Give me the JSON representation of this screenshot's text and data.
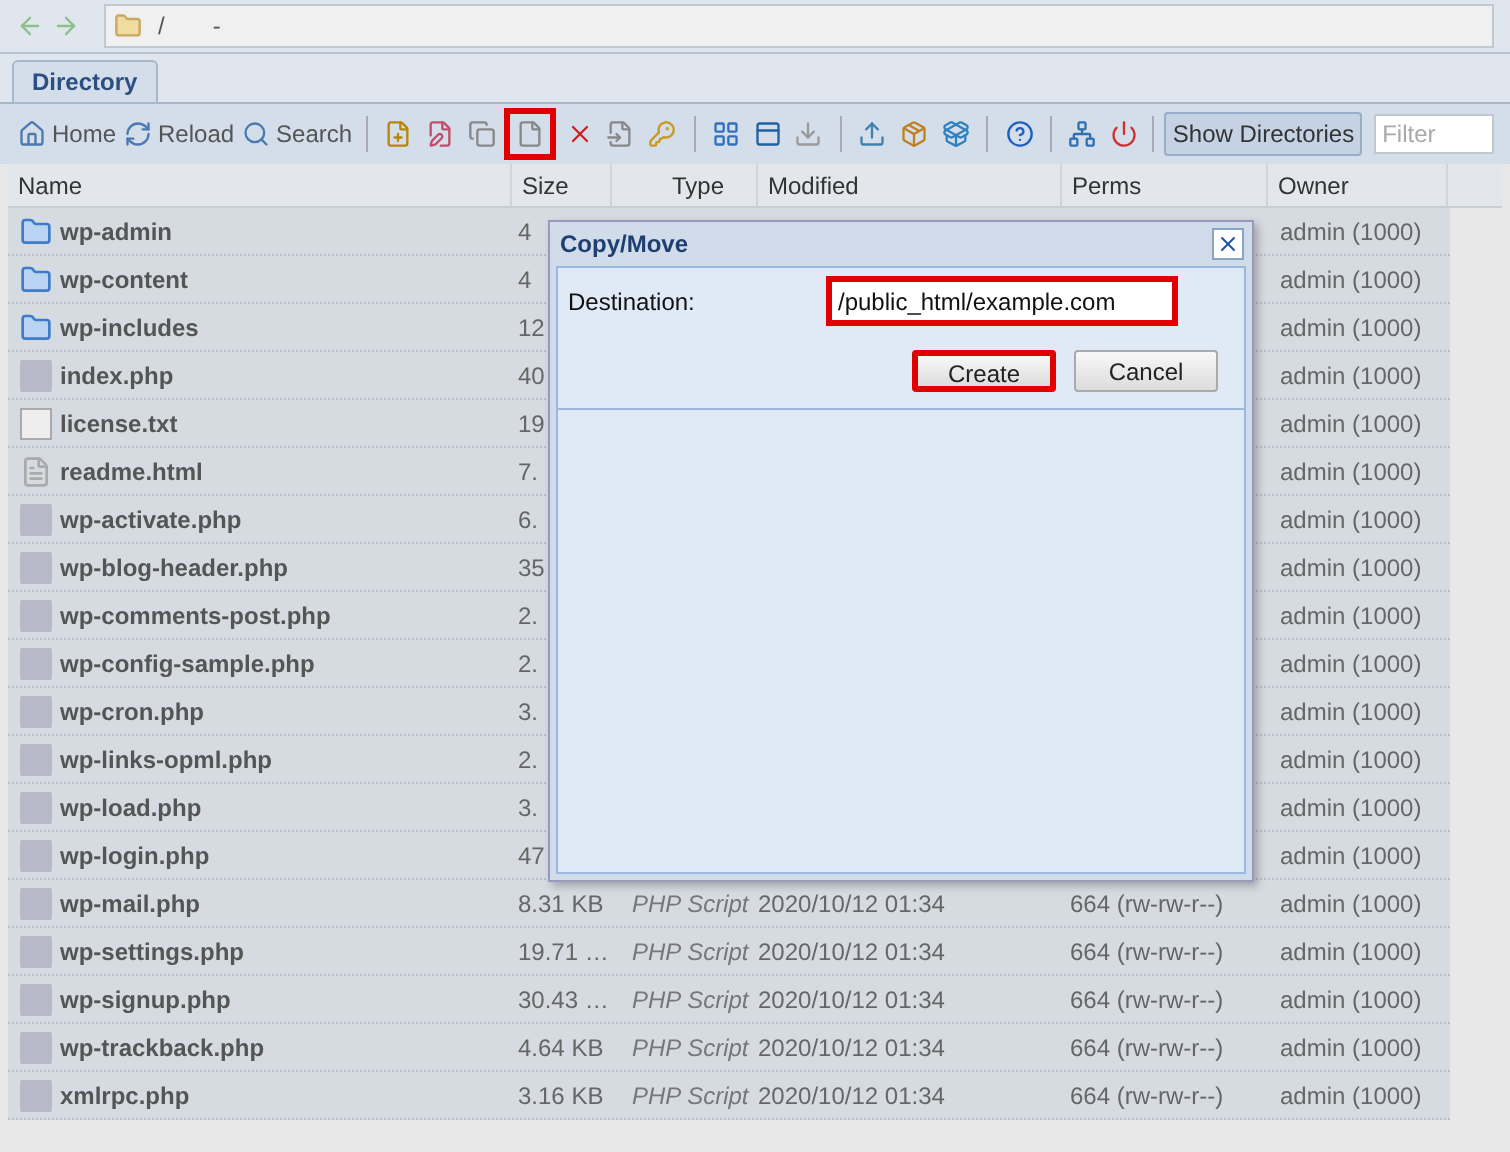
{
  "address_bar": {
    "path": "/",
    "separator": "-"
  },
  "tabs": [
    {
      "label": "Directory",
      "selected": true
    }
  ],
  "toolbar": {
    "nav_buttons": [
      "Home",
      "Reload",
      "Search"
    ],
    "icon_buttons": [
      {
        "highlighted": false
      },
      {
        "highlighted": false
      },
      {
        "highlighted": false
      },
      {
        "highlighted": true
      },
      {
        "highlighted": false
      },
      {
        "highlighted": false
      },
      {
        "highlighted": false
      },
      {
        "highlighted": false
      },
      {
        "highlighted": false
      },
      {
        "highlighted": false
      },
      {
        "highlighted": false
      },
      {
        "highlighted": false
      },
      {
        "highlighted": false
      },
      {
        "highlighted": false
      },
      {
        "highlighted": false
      },
      {
        "highlighted": false
      }
    ],
    "toggle": {
      "label": "Show Directories",
      "on": true
    },
    "filter": {
      "placeholder": "Filter"
    }
  },
  "table": {
    "columns": [
      "Name",
      "Size",
      "Type",
      "Modified",
      "Perms",
      "Owner"
    ],
    "rows": [
      {
        "kind": "folder",
        "name": "wp-admin",
        "size": "4",
        "owner": "admin (1000)"
      },
      {
        "kind": "folder",
        "name": "wp-content",
        "size": "4",
        "owner": "admin (1000)"
      },
      {
        "kind": "folder",
        "name": "wp-includes",
        "size": "12",
        "owner": "admin (1000)"
      },
      {
        "kind": "php",
        "name": "index.php",
        "size": "40",
        "owner": "admin (1000)"
      },
      {
        "kind": "text",
        "name": "license.txt",
        "size": "19",
        "owner": "admin (1000)"
      },
      {
        "kind": "html",
        "name": "readme.html",
        "size": "7.",
        "owner": "admin (1000)"
      },
      {
        "kind": "php",
        "name": "wp-activate.php",
        "size": "6.",
        "owner": "admin (1000)"
      },
      {
        "kind": "php",
        "name": "wp-blog-header.php",
        "size": "35",
        "owner": "admin (1000)"
      },
      {
        "kind": "php",
        "name": "wp-comments-post.php",
        "size": "2.",
        "owner": "admin (1000)"
      },
      {
        "kind": "php",
        "name": "wp-config-sample.php",
        "size": "2.",
        "owner": "admin (1000)"
      },
      {
        "kind": "php",
        "name": "wp-cron.php",
        "size": "3.",
        "owner": "admin (1000)"
      },
      {
        "kind": "php",
        "name": "wp-links-opml.php",
        "size": "2.",
        "owner": "admin (1000)"
      },
      {
        "kind": "php",
        "name": "wp-load.php",
        "size": "3.",
        "owner": "admin (1000)"
      },
      {
        "kind": "php",
        "name": "wp-login.php",
        "size": "47",
        "owner": "admin (1000)"
      },
      {
        "kind": "php",
        "name": "wp-mail.php",
        "size": "8.31 KB",
        "type": "PHP Script",
        "modified": "2020/10/12 01:34",
        "perms": "664 (rw-rw-r--)",
        "owner": "admin (1000)"
      },
      {
        "kind": "php",
        "name": "wp-settings.php",
        "size": "19.71 …",
        "type": "PHP Script",
        "modified": "2020/10/12 01:34",
        "perms": "664 (rw-rw-r--)",
        "owner": "admin (1000)"
      },
      {
        "kind": "php",
        "name": "wp-signup.php",
        "size": "30.43 …",
        "type": "PHP Script",
        "modified": "2020/10/12 01:34",
        "perms": "664 (rw-rw-r--)",
        "owner": "admin (1000)"
      },
      {
        "kind": "php",
        "name": "wp-trackback.php",
        "size": "4.64 KB",
        "type": "PHP Script",
        "modified": "2020/10/12 01:34",
        "perms": "664 (rw-rw-r--)",
        "owner": "admin (1000)"
      },
      {
        "kind": "php",
        "name": "xmlrpc.php",
        "size": "3.16 KB",
        "type": "PHP Script",
        "modified": "2020/10/12 01:34",
        "perms": "664 (rw-rw-r--)",
        "owner": "admin (1000)"
      }
    ]
  },
  "dialog": {
    "title": "Copy/Move",
    "field_label": "Destination:",
    "value": "/public_html/example.com",
    "value_highlighted": true,
    "buttons": [
      {
        "label": "Create",
        "highlighted": true
      },
      {
        "label": "Cancel",
        "highlighted": false
      }
    ]
  }
}
